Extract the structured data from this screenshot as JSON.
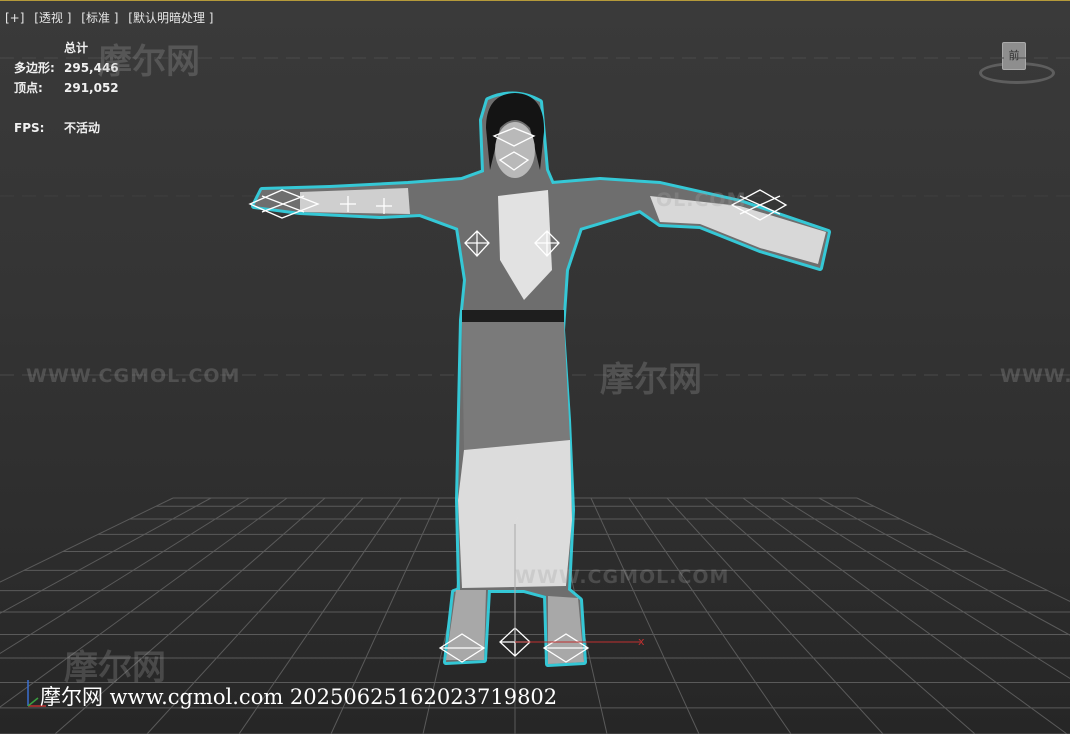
{
  "viewport_menu": {
    "plus": "[+]",
    "perspective": "[透视 ]",
    "standard": "[标准 ]",
    "shading": "[默认明暗处理 ]"
  },
  "stats": {
    "header": "总计",
    "polygons_label": "多边形:",
    "polygons_value": "295,446",
    "vertices_label": "顶点:",
    "vertices_value": "291,052",
    "fps_label": "FPS:",
    "fps_value": "不活动"
  },
  "watermarks": {
    "brand": "摩尔网",
    "url": "WWW.CGMOL.COM",
    "url_fragment": "OL.COM"
  },
  "viewcube": {
    "face_label": "前"
  },
  "axes": {
    "z": "z",
    "x": "x"
  },
  "footer": {
    "caption": "摩尔网 www.cgmol.com 20250625162023719802"
  },
  "colors": {
    "selection_outline": "#35d8e8",
    "grid": "#5a5a5a",
    "x_axis": "#c03030",
    "z_axis": "#aaaaaa"
  }
}
